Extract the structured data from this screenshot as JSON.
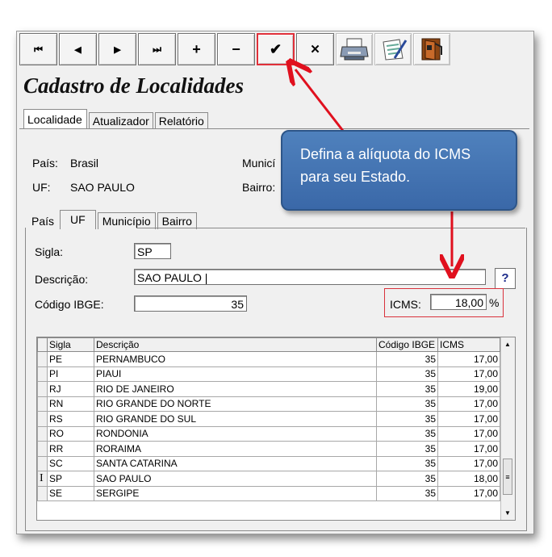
{
  "toolbar": {
    "buttons": [
      {
        "name": "first-record",
        "glyph": "⏮"
      },
      {
        "name": "prev-record",
        "glyph": "◀"
      },
      {
        "name": "next-record",
        "glyph": "▶"
      },
      {
        "name": "last-record",
        "glyph": "⏭"
      },
      {
        "name": "add",
        "glyph": "+"
      },
      {
        "name": "delete",
        "glyph": "−"
      },
      {
        "name": "confirm",
        "glyph": "✔"
      },
      {
        "name": "cancel",
        "glyph": "✕"
      }
    ],
    "icons": [
      "printer-icon",
      "notepad-icon",
      "exit-door-icon"
    ]
  },
  "title": "Cadastro de Localidades",
  "main_tabs": [
    "Localidade",
    "Atualizador",
    "Relatório"
  ],
  "summary": {
    "pais_label": "País:",
    "pais_value": "Brasil",
    "uf_label": "UF:",
    "uf_value": "SAO PAULO",
    "municipio_label": "Municí",
    "bairro_label": "Bairro:"
  },
  "sub_tabs": [
    "País",
    "UF",
    "Município",
    "Bairro"
  ],
  "form": {
    "sigla_label": "Sigla:",
    "sigla_value": "SP",
    "descricao_label": "Descrição:",
    "descricao_value": "SAO PAULO",
    "ibge_label": "Código IBGE:",
    "ibge_value": "35",
    "icms_label": "ICMS:",
    "icms_value": "18,00",
    "icms_unit": "%",
    "help_button": "?"
  },
  "grid": {
    "headers": [
      "Sigla",
      "Descrição",
      "Código IBGE",
      "ICMS"
    ],
    "rows": [
      {
        "sigla": "PE",
        "descricao": "PERNAMBUCO",
        "ibge": "35",
        "icms": "17,00"
      },
      {
        "sigla": "PI",
        "descricao": "PIAUI",
        "ibge": "35",
        "icms": "17,00"
      },
      {
        "sigla": "RJ",
        "descricao": "RIO DE JANEIRO",
        "ibge": "35",
        "icms": "19,00"
      },
      {
        "sigla": "RN",
        "descricao": "RIO GRANDE DO NORTE",
        "ibge": "35",
        "icms": "17,00"
      },
      {
        "sigla": "RS",
        "descricao": "RIO GRANDE DO SUL",
        "ibge": "35",
        "icms": "17,00"
      },
      {
        "sigla": "RO",
        "descricao": "RONDONIA",
        "ibge": "35",
        "icms": "17,00"
      },
      {
        "sigla": "RR",
        "descricao": "RORAIMA",
        "ibge": "35",
        "icms": "17,00"
      },
      {
        "sigla": "SC",
        "descricao": "SANTA CATARINA",
        "ibge": "35",
        "icms": "17,00"
      },
      {
        "sigla": "SP",
        "descricao": "SAO PAULO",
        "ibge": "35",
        "icms": "18,00",
        "current": true
      },
      {
        "sigla": "SE",
        "descricao": "SERGIPE",
        "ibge": "35",
        "icms": "17,00"
      }
    ]
  },
  "callout": {
    "text": "Defina a alíquota do ICMS para seu Estado.",
    "color": "#4f81bd",
    "arrow_color": "#e0101e"
  }
}
